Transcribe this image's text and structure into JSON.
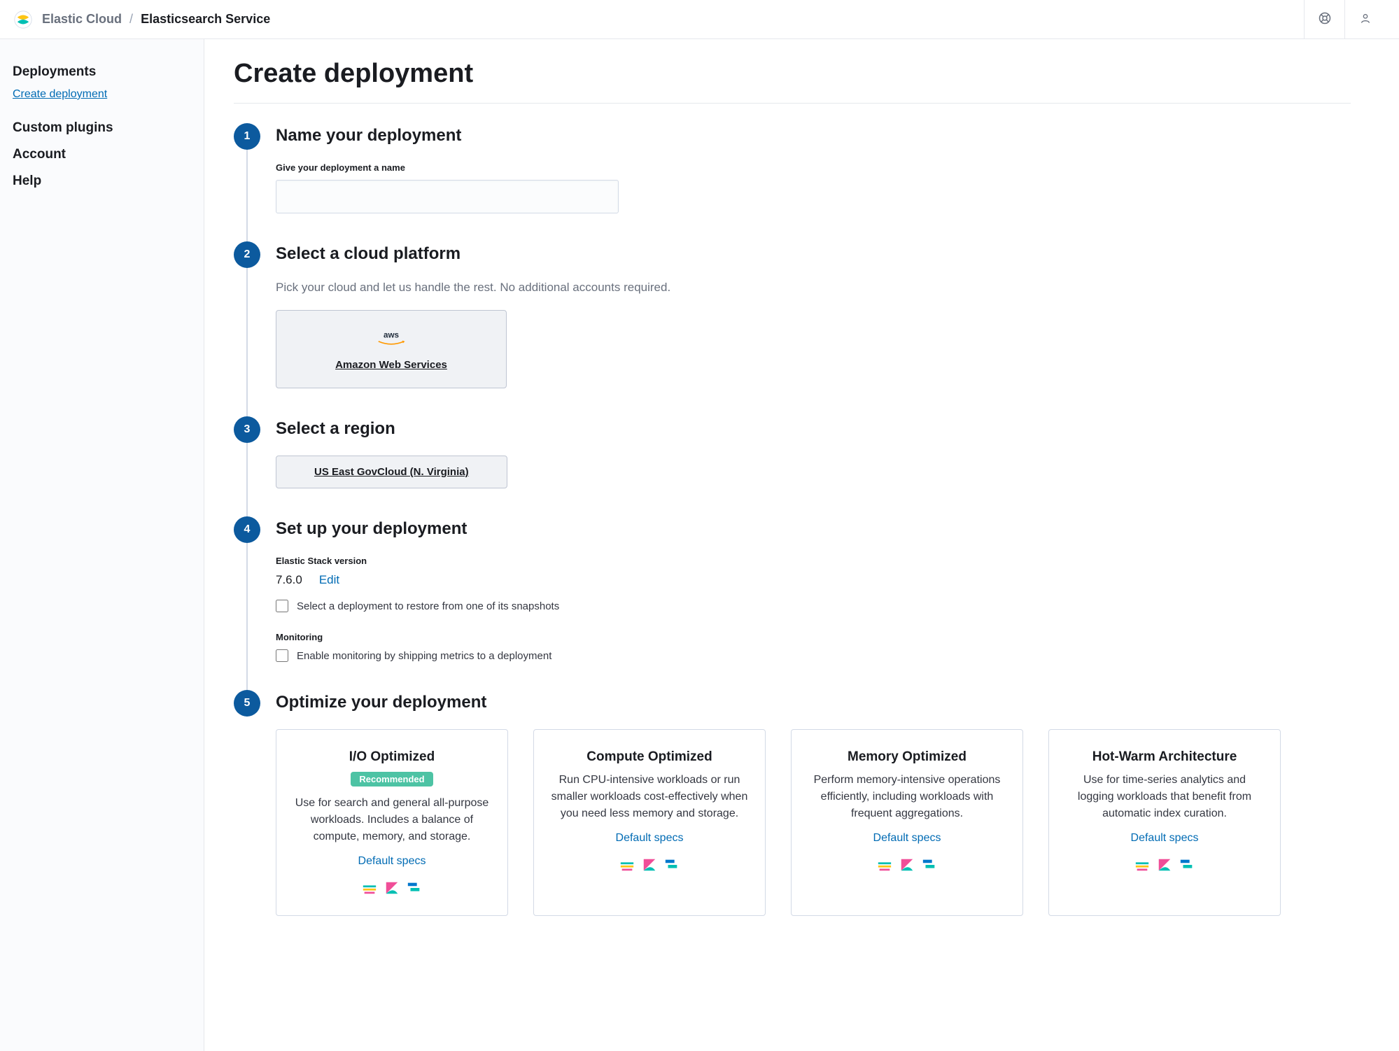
{
  "header": {
    "brand_left": "Elastic Cloud",
    "brand_right": "Elasticsearch Service"
  },
  "sidebar": {
    "items": [
      {
        "label": "Deployments",
        "sub": false
      },
      {
        "label": "Create deployment",
        "sub": true,
        "active": true
      },
      {
        "label": "Custom plugins",
        "sub": false
      },
      {
        "label": "Account",
        "sub": false
      },
      {
        "label": "Help",
        "sub": false
      }
    ]
  },
  "page": {
    "title": "Create deployment"
  },
  "steps": {
    "s1": {
      "num": "1",
      "title": "Name your deployment",
      "field_label": "Give your deployment a name",
      "value": ""
    },
    "s2": {
      "num": "2",
      "title": "Select a cloud platform",
      "subtitle": "Pick your cloud and let us handle the rest. No additional accounts required.",
      "provider_name": "aws",
      "provider_label": "Amazon Web Services"
    },
    "s3": {
      "num": "3",
      "title": "Select a region",
      "region": "US East GovCloud (N. Virginia)"
    },
    "s4": {
      "num": "4",
      "title": "Set up your deployment",
      "version_label": "Elastic Stack version",
      "version": "7.6.0",
      "edit": "Edit",
      "checkbox_restore": "Select a deployment to restore from one of its snapshots",
      "monitoring_label": "Monitoring",
      "checkbox_monitoring": "Enable monitoring by shipping metrics to a deployment"
    },
    "s5": {
      "num": "5",
      "title": "Optimize your deployment",
      "cards": [
        {
          "title": "I/O Optimized",
          "badge": "Recommended",
          "desc": "Use for search and general all-purpose workloads. Includes a balance of compute, memory, and storage.",
          "specs": "Default specs"
        },
        {
          "title": "Compute Optimized",
          "badge": "",
          "desc": "Run CPU-intensive workloads or run smaller workloads cost-effectively when you need less memory and storage.",
          "specs": "Default specs"
        },
        {
          "title": "Memory Optimized",
          "badge": "",
          "desc": "Perform memory-intensive operations efficiently, including workloads with frequent aggregations.",
          "specs": "Default specs"
        },
        {
          "title": "Hot-Warm Architecture",
          "badge": "",
          "desc": "Use for time-series analytics and logging workloads that benefit from automatic index curation.",
          "specs": "Default specs"
        }
      ]
    }
  }
}
